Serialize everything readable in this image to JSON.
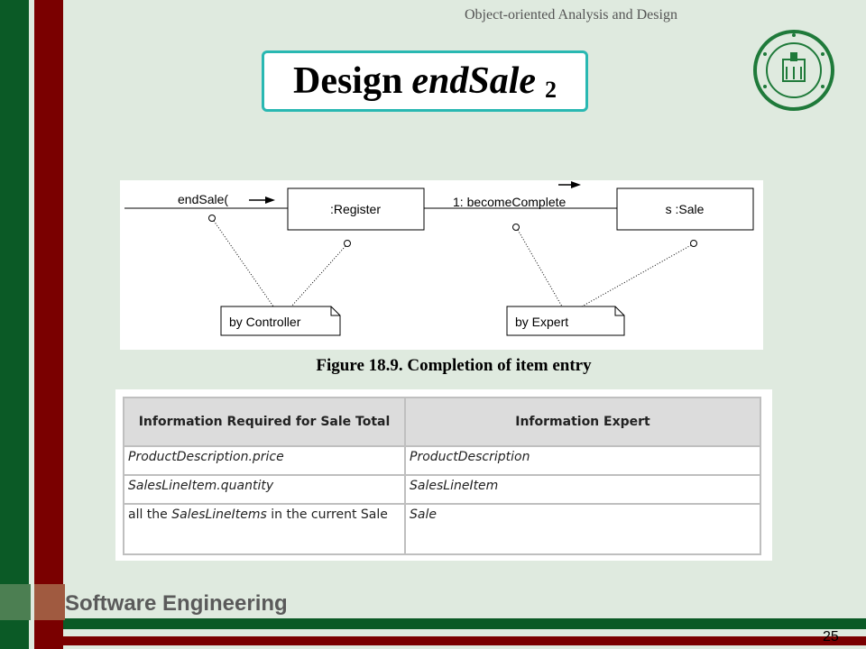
{
  "slide": {
    "header": "Object-oriented Analysis and Design",
    "title_prefix": "Design",
    "title_italic": "endSale",
    "title_number": "2",
    "footer": "Software Engineering",
    "page_number": "25"
  },
  "diagram": {
    "message1": "endSale(",
    "register_label": ":Register",
    "message2": "1: becomeComplete",
    "sale_label": "s :Sale",
    "note1": "by Controller",
    "note2": "by Expert"
  },
  "figure_caption": "Figure 18.9. Completion of item entry",
  "table": {
    "headers": [
      "Information Required for Sale Total",
      "Information Expert"
    ],
    "rows": [
      [
        "ProductDescription.price",
        "ProductDescription"
      ],
      [
        "SalesLineItem.quantity",
        "SalesLineItem"
      ]
    ],
    "row3": {
      "prefix": "all the ",
      "italic": "SalesLineItems",
      "suffix": " in the current Sale",
      "expert": "Sale"
    }
  },
  "colors": {
    "green_bar": "#0b5a26",
    "red_bar": "#7a0000",
    "title_border": "#29b8b2",
    "background": "#dfeadf"
  }
}
